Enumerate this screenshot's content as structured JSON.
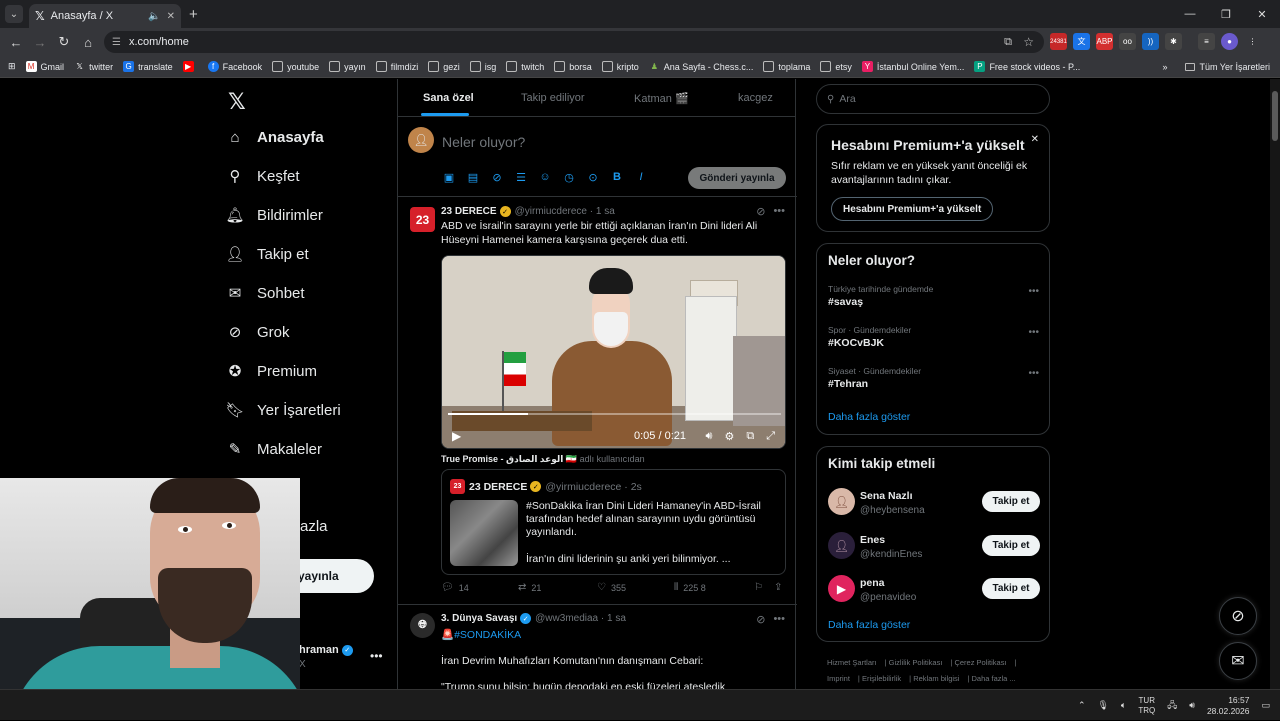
{
  "browser": {
    "tab_title": "Anasayfa / X",
    "url": "x.com/home",
    "bookmarks": [
      "Gmail",
      "twitter",
      "translate",
      "Facebook",
      "youtube",
      "yayın",
      "filmdizi",
      "gezi",
      "isg",
      "twitch",
      "borsa",
      "kripto",
      "Ana Sayfa - Chess.c...",
      "toplama",
      "etsy",
      "İstanbul Online Yem...",
      "Free stock videos - P..."
    ],
    "bookmarks_right": "Tüm Yer İşaretleri",
    "ext_badge": "24381"
  },
  "nav": {
    "items": [
      "Anasayfa",
      "Keşfet",
      "Bildirimler",
      "Takip et",
      "Sohbet",
      "Grok",
      "Premium",
      "Yer İşaretleri",
      "Makaleler"
    ],
    "more_partial": "azla",
    "post_button": "yayınla",
    "profile_name": "hraman",
    "profile_handle": "X"
  },
  "feed": {
    "tabs": [
      "Sana özel",
      "Takip ediliyor",
      "Katman 🎬",
      "kacgez"
    ],
    "compose_placeholder": "Neler oluyor?",
    "compose_button": "Gönderi yayınla",
    "tweet1": {
      "avatar_text": "23",
      "name": "23 DERECE",
      "handle": "@yirmiucderece · 1 sa",
      "text": "ABD ve İsrail'in sarayını yerle bir ettiği açıklanan İran'ın Dini lideri Ali Hüseyni Hamenei kamera karşısına geçerek dua etti.",
      "video_time": "0:05 / 0:21",
      "video_progress": 0.24,
      "source_name": "True Promise - الوعد الصادق 🇮🇷",
      "source_suffix": "adlı kullanıcıdan",
      "quote_name": "23 DERECE",
      "quote_handle": "@yirmiucderece · 2s",
      "quote_text": "#SonDakika İran Dini Lideri Hamaney'in ABD-İsrail tarafından hedef alınan sarayının uydu görüntüsü yayınlandı.",
      "quote_text2": "İran'ın dini liderinin şu anki yeri bilinmiyor.  ...",
      "replies": "14",
      "reposts": "21",
      "likes": "355",
      "views": "225 8"
    },
    "tweet2": {
      "name": "3. Dünya Savaşı",
      "handle": "@ww3mediaa · 1 sa",
      "line1": "🚨#SONDAKİKA",
      "line2": "İran Devrim Muhafızları Komutanı'nın danışmanı Cebari:",
      "line3": "\"Trump şunu bilsin: bugün depodaki en eski füzeleri ateşledik"
    }
  },
  "right": {
    "search_placeholder": "Ara",
    "premium_title": "Hesabını Premium+'a yükselt",
    "premium_text": "Sıfır reklam ve en yüksek yanıt önceliği ek avantajlarının tadını çıkar.",
    "premium_button": "Hesabını Premium+'a yükselt",
    "trends_title": "Neler oluyor?",
    "trends": [
      {
        "category": "Türkiye tarihinde gündemde",
        "name": "#savaş"
      },
      {
        "category": "Spor · Gündemdekiler",
        "name": "#KOCvBJK"
      },
      {
        "category": "Siyaset · Gündemdekiler",
        "name": "#Tehran"
      }
    ],
    "show_more": "Daha fazla göster",
    "who_title": "Kimi takip etmeli",
    "who": [
      {
        "name": "Sena Nazlı",
        "handle": "@heybensena"
      },
      {
        "name": "Enes",
        "handle": "@kendinEnes"
      },
      {
        "name": "pena",
        "handle": "@penavideo"
      }
    ],
    "follow_label": "Takip et",
    "footer": [
      "Hizmet Şartları",
      "Gizlilik Politikası",
      "Çerez Politikası",
      "Imprint",
      "Erişilebilirlik",
      "Reklam bilgisi",
      "Daha fazla ..."
    ]
  },
  "taskbar": {
    "lang": "TUR",
    "lang2": "TRQ",
    "time": "16:57",
    "date": "28.02.2026"
  }
}
